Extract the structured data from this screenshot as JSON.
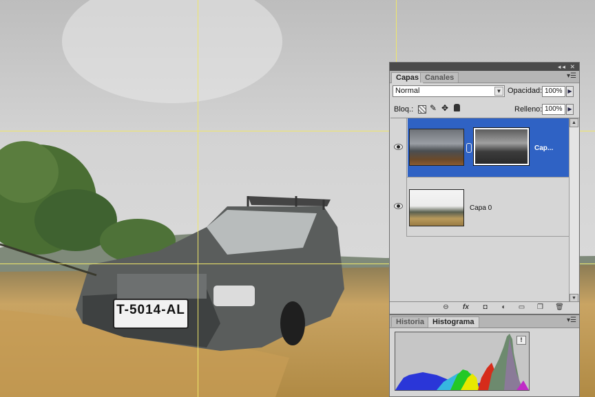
{
  "canvas": {
    "plate_text": "T-5014-AL"
  },
  "layers_panel": {
    "tabs": [
      {
        "label": "Capas",
        "active": true
      },
      {
        "label": "Canales",
        "active": false
      }
    ],
    "blend_mode": "Normal",
    "opacity_label": "Opacidad:",
    "opacity_value": "100%",
    "lock_label": "Bloq.:",
    "fill_label": "Relleno:",
    "fill_value": "100%",
    "layers": [
      {
        "name": "Cap...",
        "selected": true,
        "visible": true,
        "has_mask": true
      },
      {
        "name": "Capa 0",
        "selected": false,
        "visible": true,
        "has_mask": false
      }
    ],
    "bottom_icons": [
      "link-icon",
      "fx-icon",
      "mask-icon",
      "adjustment-icon",
      "group-folder-icon",
      "new-layer-icon",
      "trash-icon"
    ],
    "fx_label": "fx"
  },
  "histogram_panel": {
    "tabs": [
      {
        "label": "Historia",
        "active": false
      },
      {
        "label": "Histograma",
        "active": true
      }
    ],
    "warning_glyph": "!"
  },
  "colors": {
    "selected_layer": "#2f62c4",
    "guide_line": "#f0e86a",
    "panel_bg": "#d6d6d6"
  }
}
